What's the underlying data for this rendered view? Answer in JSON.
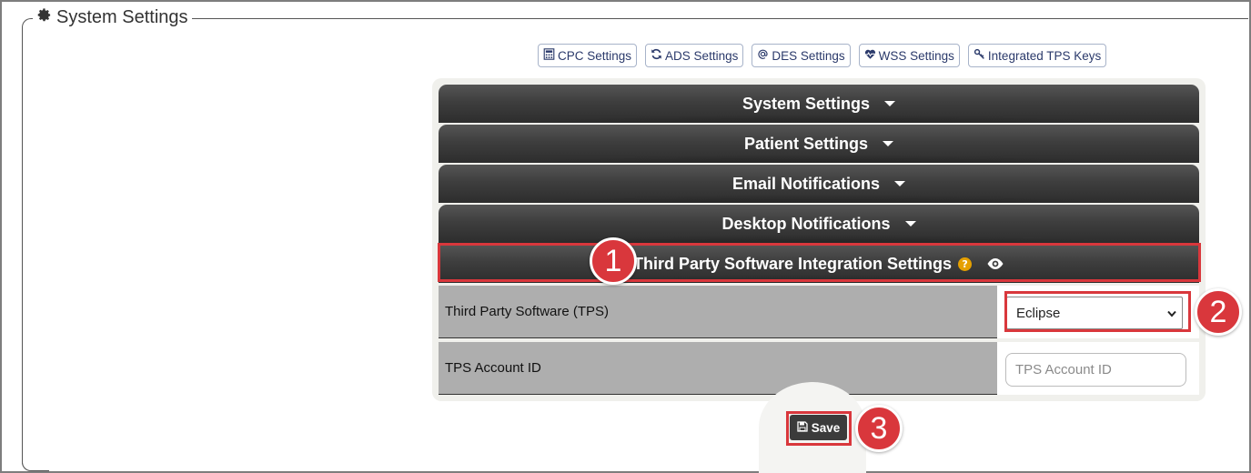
{
  "legend": {
    "title": "System Settings",
    "icon": "gear-icon"
  },
  "toolbar": {
    "buttons": [
      {
        "label": "CPC Settings",
        "icon": "calculator-icon"
      },
      {
        "label": "ADS Settings",
        "icon": "refresh-icon"
      },
      {
        "label": "DES Settings",
        "icon": "at-icon"
      },
      {
        "label": "WSS Settings",
        "icon": "heartbeat-icon"
      },
      {
        "label": "Integrated TPS Keys",
        "icon": "key-icon"
      }
    ]
  },
  "accordion": {
    "sections": [
      {
        "label": "System Settings"
      },
      {
        "label": "Patient Settings"
      },
      {
        "label": "Email Notifications"
      },
      {
        "label": "Desktop Notifications"
      }
    ],
    "active": {
      "label": "Third Party Software Integration Settings",
      "help_icon": "?"
    }
  },
  "form": {
    "tps_label": "Third Party Software (TPS)",
    "tps_value": "Eclipse",
    "account_label": "TPS Account ID",
    "account_placeholder": "TPS Account ID"
  },
  "save": {
    "label": "Save"
  },
  "steps": [
    "1",
    "2",
    "3"
  ],
  "colors": {
    "highlight": "#d9373c",
    "header_dark": "#3e3e3e",
    "help": "#e5a000"
  }
}
